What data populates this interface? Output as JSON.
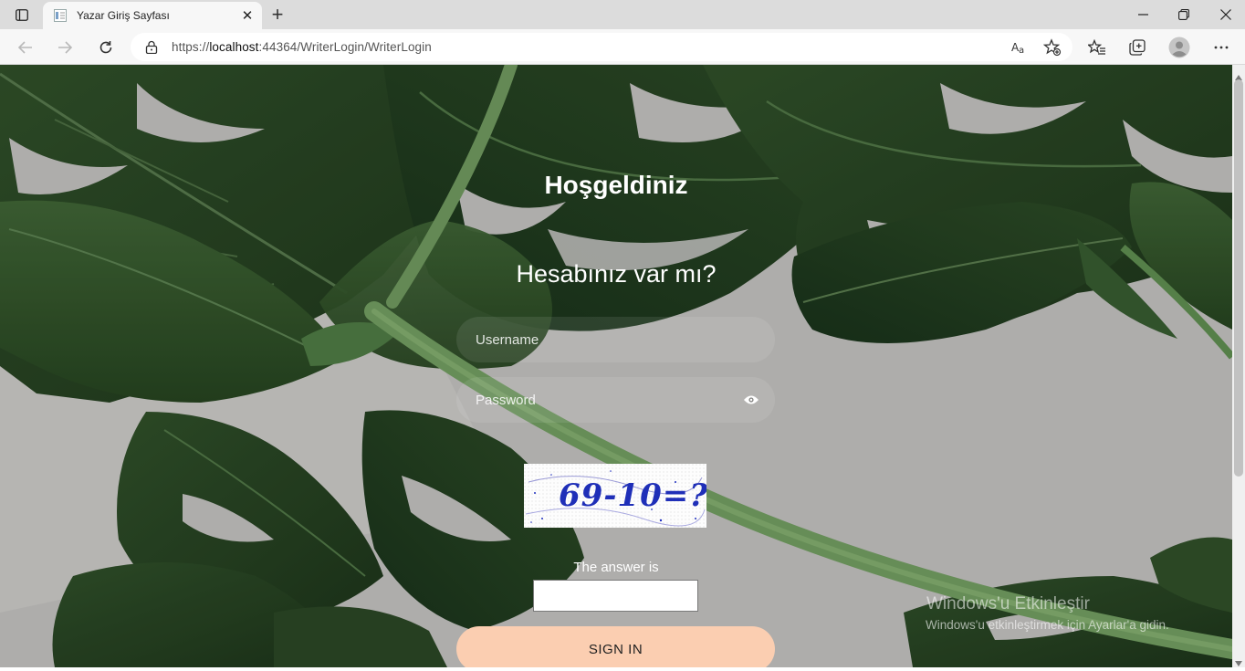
{
  "browser": {
    "tab_title": "Yazar Giriş Sayfası",
    "tab_close": "✕",
    "new_tab": "+",
    "url_scheme": "https://",
    "url_host": "localhost",
    "url_path": ":44364/WriterLogin/WriterLogin",
    "icons": [
      "tab-actions-icon",
      "back-icon",
      "forward-icon",
      "refresh-icon",
      "lock-icon",
      "read-aloud-icon",
      "add-favorite-icon",
      "favorites-icon",
      "collections-icon",
      "profile-icon",
      "more-icon",
      "minimize-icon",
      "restore-icon",
      "close-window-icon"
    ]
  },
  "page": {
    "welcome": "Hoşgeldiniz",
    "question": "Hesabınız var mı?",
    "username_placeholder": "Username",
    "password_placeholder": "Password",
    "captcha_text": "69-10=?",
    "answer_label": "The answer is",
    "signin_label": "SIGN IN"
  },
  "watermark": {
    "title": "Windows'u Etkinleştir",
    "subtitle": "Windows'u etkinleştirmek için Ayarlar'a gidin."
  },
  "colors": {
    "signin_bg": "#fbceb1",
    "leaf_dark": "#1f3a1c",
    "leaf_mid": "#35562e",
    "stem": "#5d8a4f"
  }
}
